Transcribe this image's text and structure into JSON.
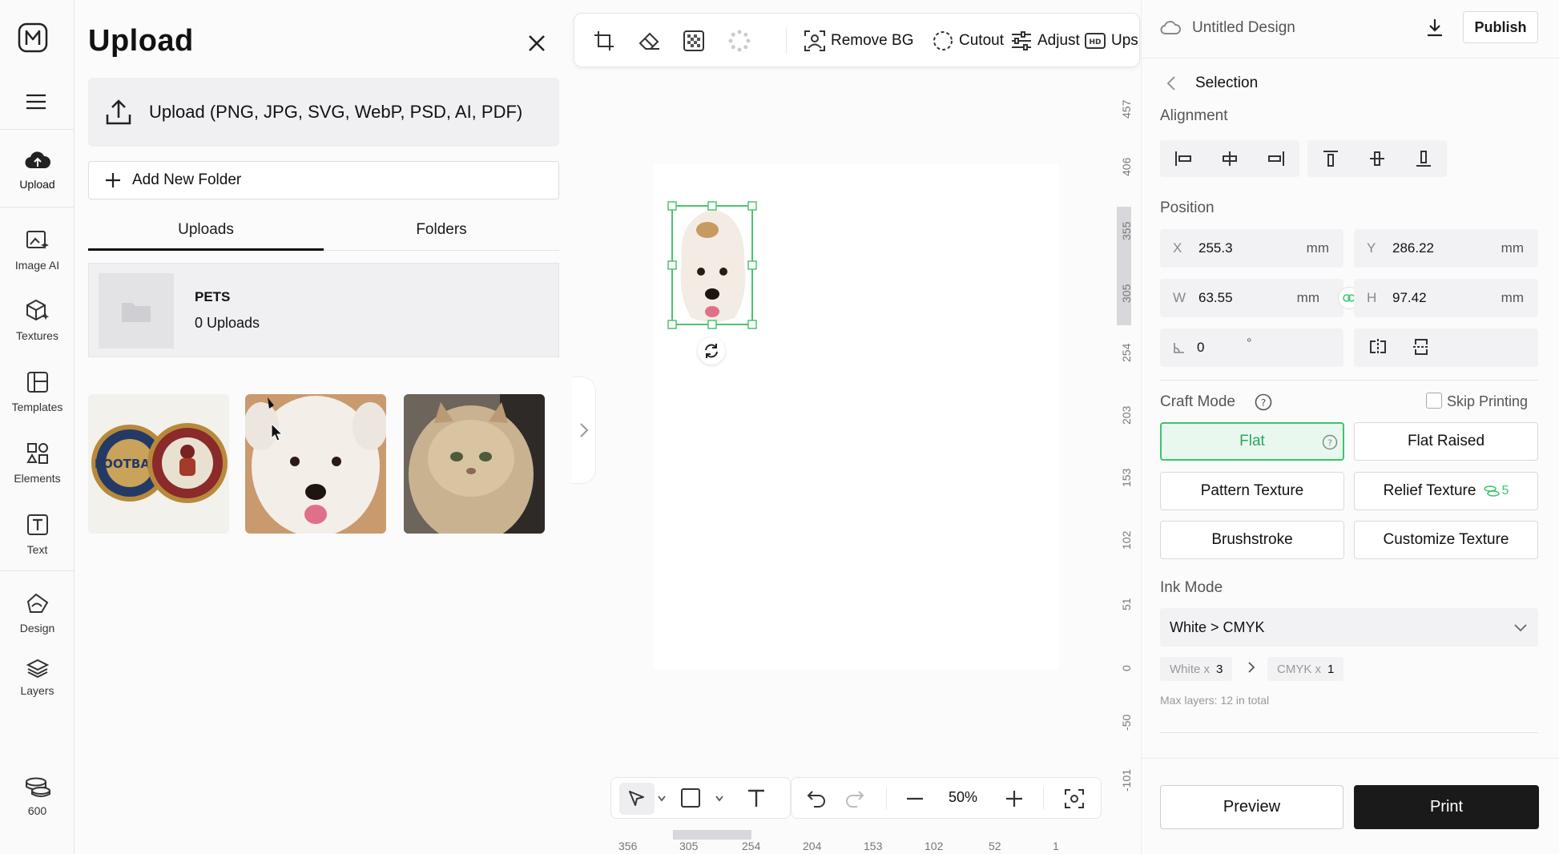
{
  "rail": {
    "items": [
      {
        "label": "Upload",
        "icon": "cloud-upload-icon"
      },
      {
        "label": "Image AI",
        "icon": "image-ai-icon"
      },
      {
        "label": "Textures",
        "icon": "textures-icon"
      },
      {
        "label": "Templates",
        "icon": "templates-icon"
      },
      {
        "label": "Elements",
        "icon": "elements-icon"
      },
      {
        "label": "Text",
        "icon": "text-icon"
      },
      {
        "label": "Design",
        "icon": "design-icon"
      },
      {
        "label": "Layers",
        "icon": "layers-icon"
      }
    ],
    "credits": "600"
  },
  "upload_panel": {
    "title": "Upload",
    "upload_label": "Upload (PNG, JPG, SVG, WebP, PSD, AI, PDF)",
    "add_folder_label": "Add New Folder",
    "tabs": [
      {
        "label": "Uploads",
        "active": true
      },
      {
        "label": "Folders",
        "active": false
      }
    ],
    "folder": {
      "name": "PETS",
      "count": "0 Uploads"
    }
  },
  "toolbar": {
    "remove_bg": "Remove BG",
    "cutout": "Cutout",
    "adjust": "Adjust",
    "upscale": "Ups"
  },
  "zoom": {
    "value": "50%"
  },
  "rulers": {
    "vertical": [
      "457",
      "406",
      "355",
      "305",
      "254",
      "203",
      "153",
      "102",
      "51",
      "0",
      "-50",
      "-101"
    ],
    "horizontal": [
      "356",
      "305",
      "254",
      "204",
      "153",
      "102",
      "52",
      "1"
    ]
  },
  "header": {
    "title": "Untitled Design",
    "publish": "Publish"
  },
  "selection": {
    "back_title": "Selection",
    "alignment_label": "Alignment",
    "position_label": "Position",
    "x": {
      "label": "X",
      "value": "255.3",
      "unit": "mm"
    },
    "y": {
      "label": "Y",
      "value": "286.22",
      "unit": "mm"
    },
    "w": {
      "label": "W",
      "value": "63.55",
      "unit": "mm"
    },
    "h": {
      "label": "H",
      "value": "97.42",
      "unit": "mm"
    },
    "rotation": {
      "value": "0",
      "unit": "°"
    }
  },
  "craft": {
    "label": "Craft Mode",
    "skip_printing": "Skip Printing",
    "modes": {
      "flat": "Flat",
      "flat_raised": "Flat Raised",
      "pattern": "Pattern Texture",
      "relief": "Relief Texture",
      "relief_cost": "5",
      "brush": "Brushstroke",
      "customize": "Customize Texture"
    },
    "accent": "#3cc46e"
  },
  "ink": {
    "label": "Ink Mode",
    "selected": "White > CMYK",
    "white_label": "White x",
    "white_value": "3",
    "cmyk_label": "CMYK x",
    "cmyk_value": "1",
    "note": "Max layers: 12 in total"
  },
  "actions": {
    "preview": "Preview",
    "print": "Print"
  }
}
